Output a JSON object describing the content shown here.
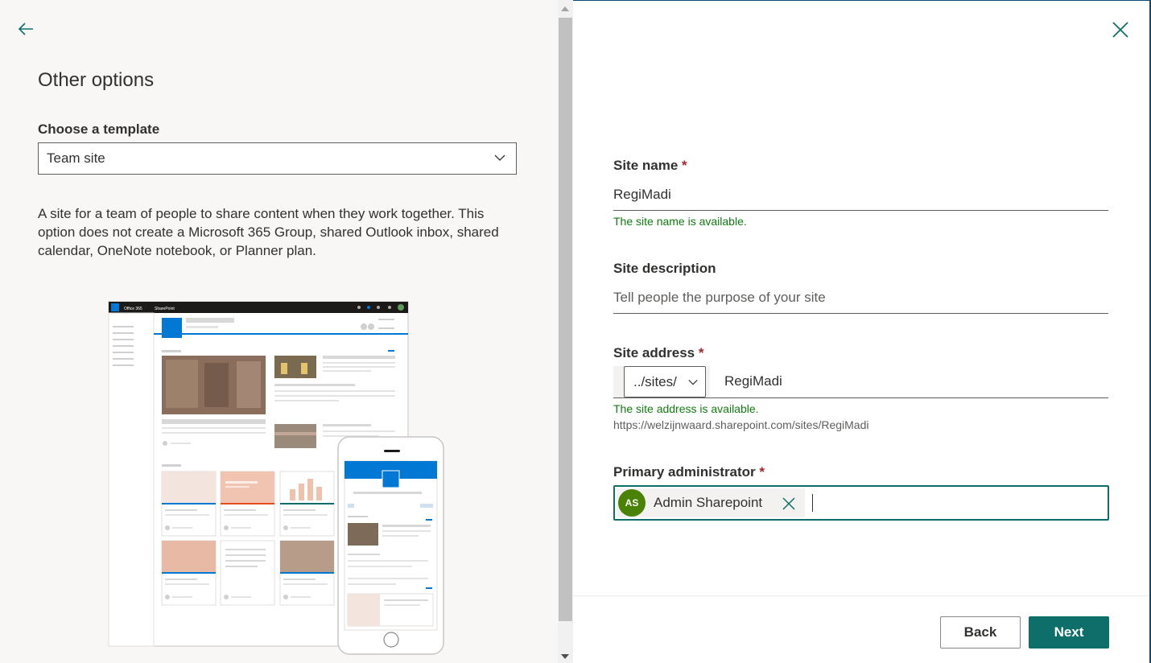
{
  "left_panel": {
    "title": "Other options",
    "template_label": "Choose a template",
    "template_value": "Team site",
    "description": "A site for a team of people to share content when they work together. This option does not create a Microsoft 365 Group, shared Outlook inbox, shared calendar, OneNote notebook, or Planner plan.",
    "preview": {
      "app_name": "Office 365",
      "product": "SharePoint"
    }
  },
  "form": {
    "site_name": {
      "label": "Site name",
      "required_mark": "*",
      "value": "RegiMadi",
      "status": "The site name is available."
    },
    "site_description": {
      "label": "Site description",
      "placeholder": "Tell people the purpose of your site"
    },
    "site_address": {
      "label": "Site address",
      "required_mark": "*",
      "prefix": "../sites/",
      "value": "RegiMadi",
      "status": "The site address is available.",
      "url": "https://welzijnwaard.sharepoint.com/sites/RegiMadi"
    },
    "primary_admin": {
      "label": "Primary administrator",
      "required_mark": "*",
      "initials": "AS",
      "name": "Admin Sharepoint"
    }
  },
  "buttons": {
    "back": "Back",
    "next": "Next"
  },
  "icons": {
    "back": "back-arrow-icon",
    "close": "close-icon",
    "chevron": "chevron-down-icon",
    "remove": "remove-icon"
  },
  "colors": {
    "accent": "#0e6e6a",
    "success": "#107c10",
    "required": "#a4262c",
    "avatar": "#498205"
  }
}
